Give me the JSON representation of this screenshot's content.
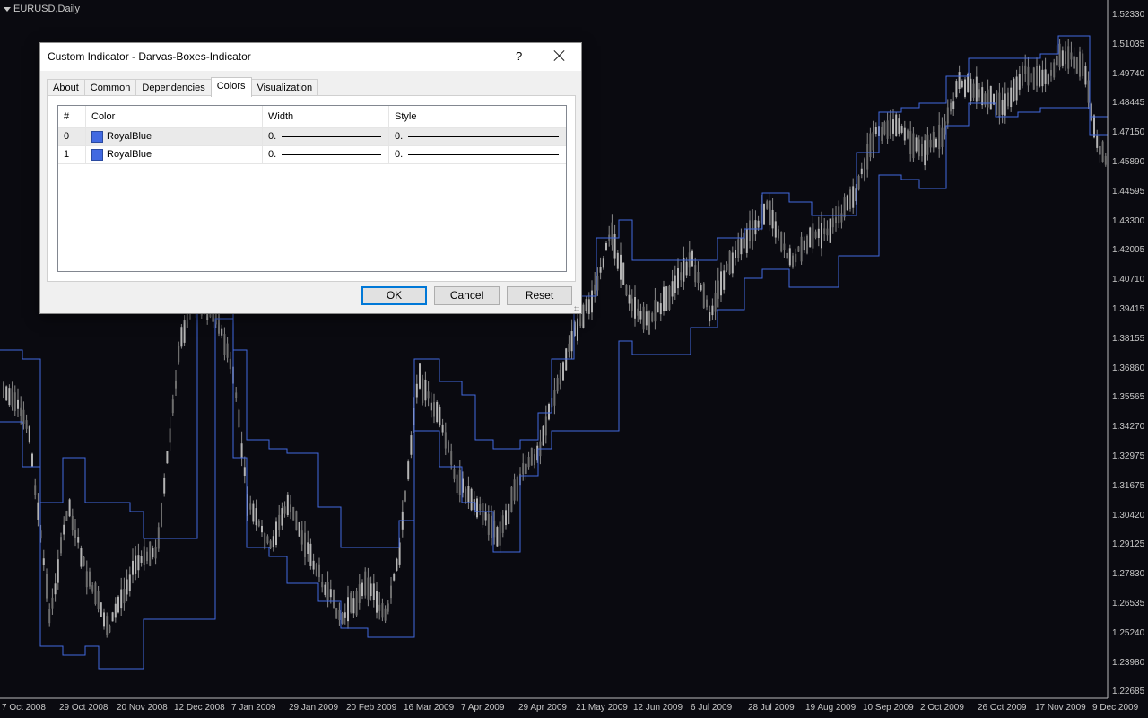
{
  "chart": {
    "symbol_title": "EURUSD,Daily",
    "price_labels": [
      "1.52330",
      "1.51035",
      "1.49740",
      "1.48445",
      "1.47150",
      "1.45890",
      "1.44595",
      "1.43300",
      "1.42005",
      "1.40710",
      "1.39415",
      "1.38155",
      "1.36860",
      "1.35565",
      "1.34270",
      "1.32975",
      "1.31675",
      "1.30420",
      "1.29125",
      "1.27830",
      "1.26535",
      "1.25240",
      "1.23980",
      "1.22685"
    ],
    "date_labels": [
      "7 Oct 2008",
      "29 Oct 2008",
      "20 Nov 2008",
      "12 Dec 2008",
      "7 Jan 2009",
      "29 Jan 2009",
      "20 Feb 2009",
      "16 Mar 2009",
      "7 Apr 2009",
      "29 Apr 2009",
      "21 May 2009",
      "12 Jun 2009",
      "6 Jul 2009",
      "28 Jul 2009",
      "19 Aug 2009",
      "10 Sep 2009",
      "2 Oct 2009",
      "26 Oct 2009",
      "17 Nov 2009",
      "9 Dec 2009"
    ],
    "colors": {
      "background": "#0a0a10",
      "candle": "#a0a0a0",
      "box_line": "#4169e1"
    }
  },
  "dialog": {
    "title": "Custom Indicator - Darvas-Boxes-Indicator",
    "help": "?",
    "tabs": [
      "About",
      "Common",
      "Dependencies",
      "Colors",
      "Visualization"
    ],
    "active_tab": "Colors",
    "columns": [
      "#",
      "Color",
      "Width",
      "Style"
    ],
    "rows": [
      {
        "index": "0",
        "color": "RoyalBlue",
        "width": "0.",
        "style": "0."
      },
      {
        "index": "1",
        "color": "RoyalBlue",
        "width": "0.",
        "style": "0."
      }
    ],
    "buttons": {
      "ok": "OK",
      "cancel": "Cancel",
      "reset": "Reset"
    }
  }
}
